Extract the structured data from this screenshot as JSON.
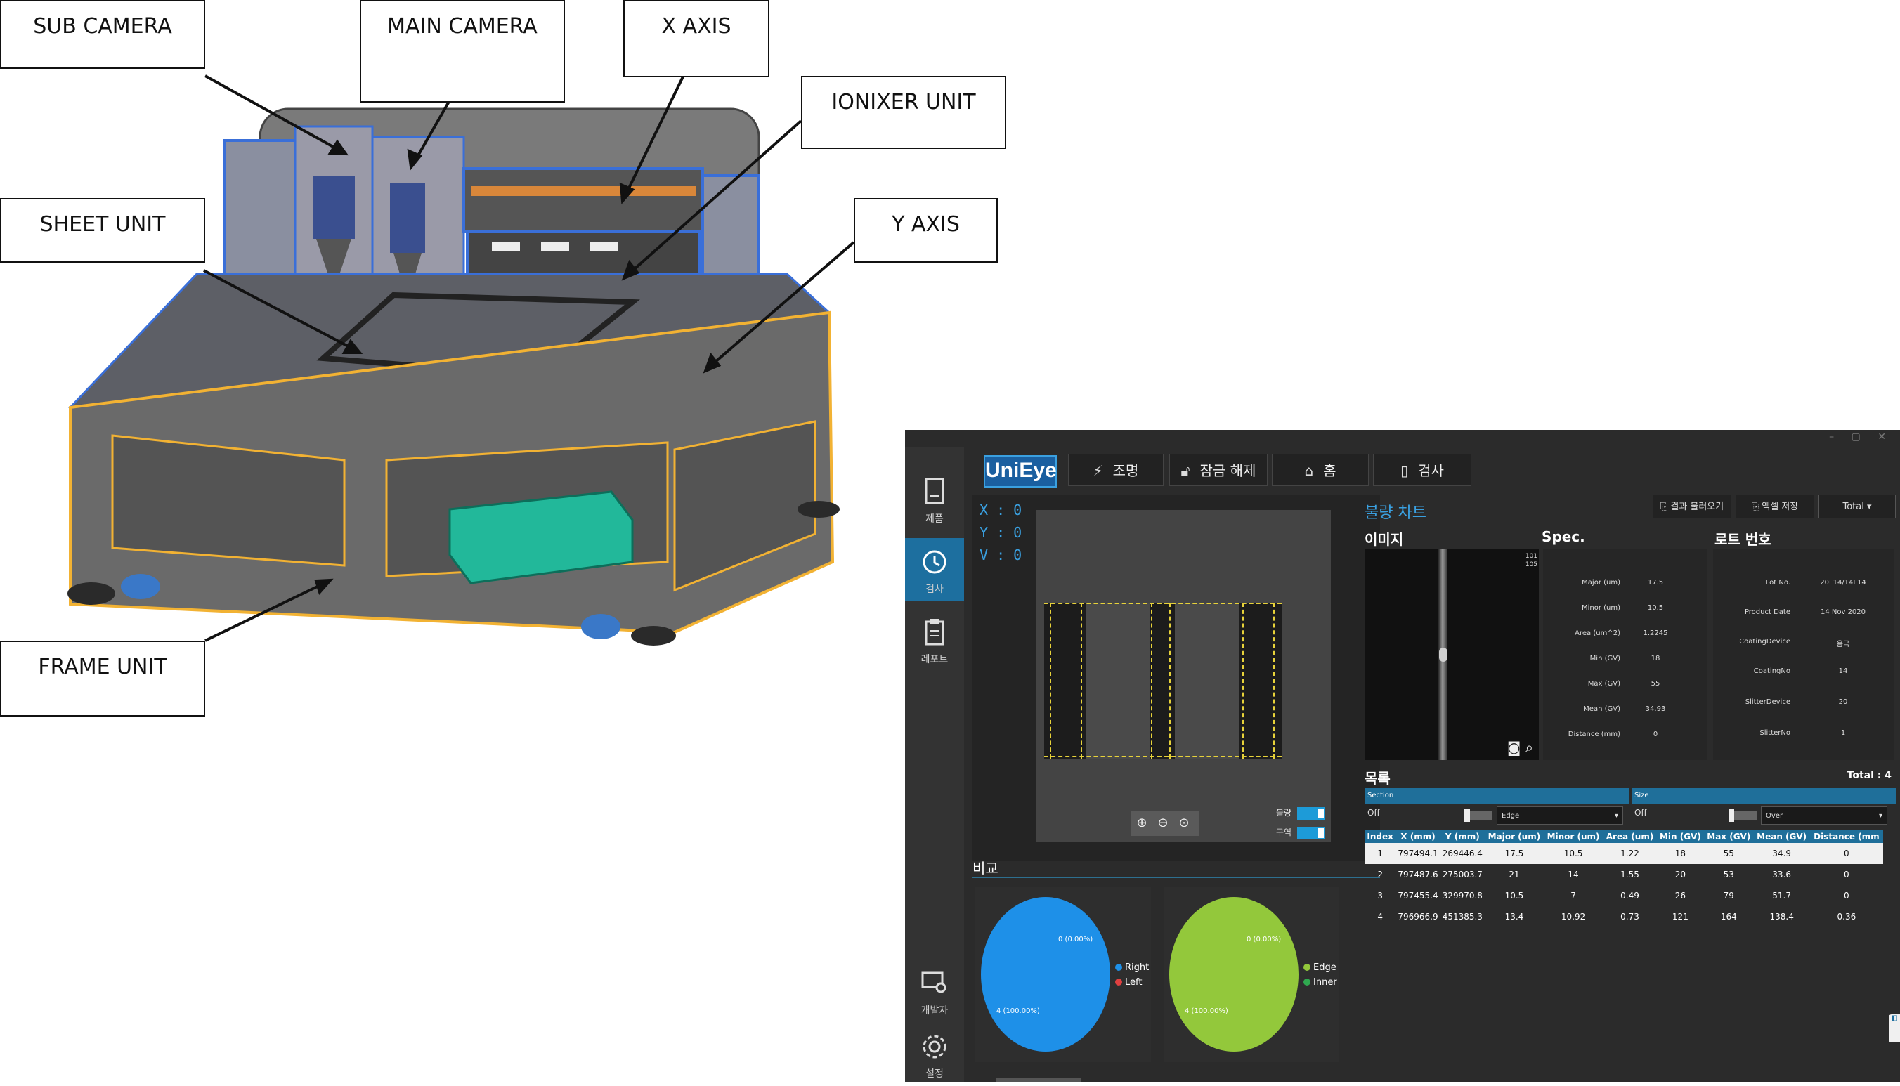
{
  "drawing": {
    "callouts": {
      "sub_camera": "SUB CAMERA",
      "main_camera": "MAIN CAMERA",
      "x_axis": "X AXIS",
      "ionixer_unit": "IONIXER UNIT",
      "sheet_unit": "SHEET UNIT",
      "y_axis": "Y AXIS",
      "frame_unit": "FRAME UNIT"
    },
    "colors": {
      "frame": "#f2b233",
      "body": "#6a6a6a",
      "blue": "#3a6fd8",
      "teal": "#22b89a"
    }
  },
  "app": {
    "logo": "UniEye",
    "nav": {
      "lighting": "조명",
      "unlock": "잠금 해제",
      "home": "홈",
      "inspect": "검사"
    },
    "sidebar": {
      "product": "제품",
      "inspect": "검사",
      "report": "레포트",
      "developer": "개발자",
      "settings": "설정"
    },
    "viewer": {
      "x": "X : 0",
      "y": "Y : 0",
      "v": "V : 0",
      "toggle_defect": "불량",
      "toggle_region": "구역"
    },
    "compare": {
      "title": "비교",
      "pie1": {
        "label_top": "0 (0.00%)",
        "label_bottom": "4 (100.00%)",
        "legend": [
          "Right",
          "Left"
        ]
      },
      "pie2": {
        "label_top": "0 (0.00%)",
        "label_bottom": "4 (100.00%)",
        "legend": [
          "Edge",
          "Inner"
        ]
      }
    },
    "right": {
      "title": "불량 차트",
      "btn_load": "결과 불러오기",
      "btn_excel": "엑셀 저장",
      "select_total": "Total",
      "image_title": "이미지",
      "image_numbers": [
        "101",
        "105"
      ],
      "spec_title": "Spec.",
      "lot_title": "로트 번호",
      "spec": [
        {
          "k": "Major (um)",
          "v": "17.5"
        },
        {
          "k": "Minor (um)",
          "v": "10.5"
        },
        {
          "k": "Area (um^2)",
          "v": "1.2245"
        },
        {
          "k": "Min (GV)",
          "v": "18"
        },
        {
          "k": "Max (GV)",
          "v": "55"
        },
        {
          "k": "Mean (GV)",
          "v": "34.93"
        },
        {
          "k": "Distance (mm)",
          "v": "0"
        }
      ],
      "lot": [
        {
          "k": "Lot No.",
          "v": "20L14/14L14"
        },
        {
          "k": "Product Date",
          "v": "14 Nov 2020"
        },
        {
          "k": "CoatingDevice",
          "v": "음극"
        },
        {
          "k": "CoatingNo",
          "v": "14"
        },
        {
          "k": "SlitterDevice",
          "v": "20"
        },
        {
          "k": "SlitterNo",
          "v": "1"
        }
      ],
      "list_title": "목록",
      "list_total": "Total : 4",
      "filters": {
        "section_label": "Section",
        "section_state": "Off",
        "section_value": "Edge",
        "size_label": "Size",
        "size_state": "Off",
        "size_value": "Over"
      },
      "table": {
        "headers": [
          "Index",
          "X (mm)",
          "Y (mm)",
          "Major (um)",
          "Minor (um)",
          "Area (um)",
          "Min (GV)",
          "Max (GV)",
          "Mean (GV)",
          "Distance (mm"
        ],
        "rows": [
          [
            "1",
            "797494.1",
            "269446.4",
            "17.5",
            "10.5",
            "1.22",
            "18",
            "55",
            "34.9",
            "0"
          ],
          [
            "2",
            "797487.6",
            "275003.7",
            "21",
            "14",
            "1.55",
            "20",
            "53",
            "33.6",
            "0"
          ],
          [
            "3",
            "797455.4",
            "329970.8",
            "10.5",
            "7",
            "0.49",
            "26",
            "79",
            "51.7",
            "0"
          ],
          [
            "4",
            "796966.9",
            "451385.3",
            "13.4",
            "10.92",
            "0.73",
            "121",
            "164",
            "138.4",
            "0.36"
          ]
        ]
      }
    },
    "colors": {
      "accent": "#1d9bd8",
      "pie1": "#1e90e8",
      "pie2": "#93c83b",
      "legend_right": "#1e90e8",
      "legend_left": "#e04040",
      "legend_edge": "#93c83b",
      "legend_inner": "#2fa84f"
    }
  }
}
